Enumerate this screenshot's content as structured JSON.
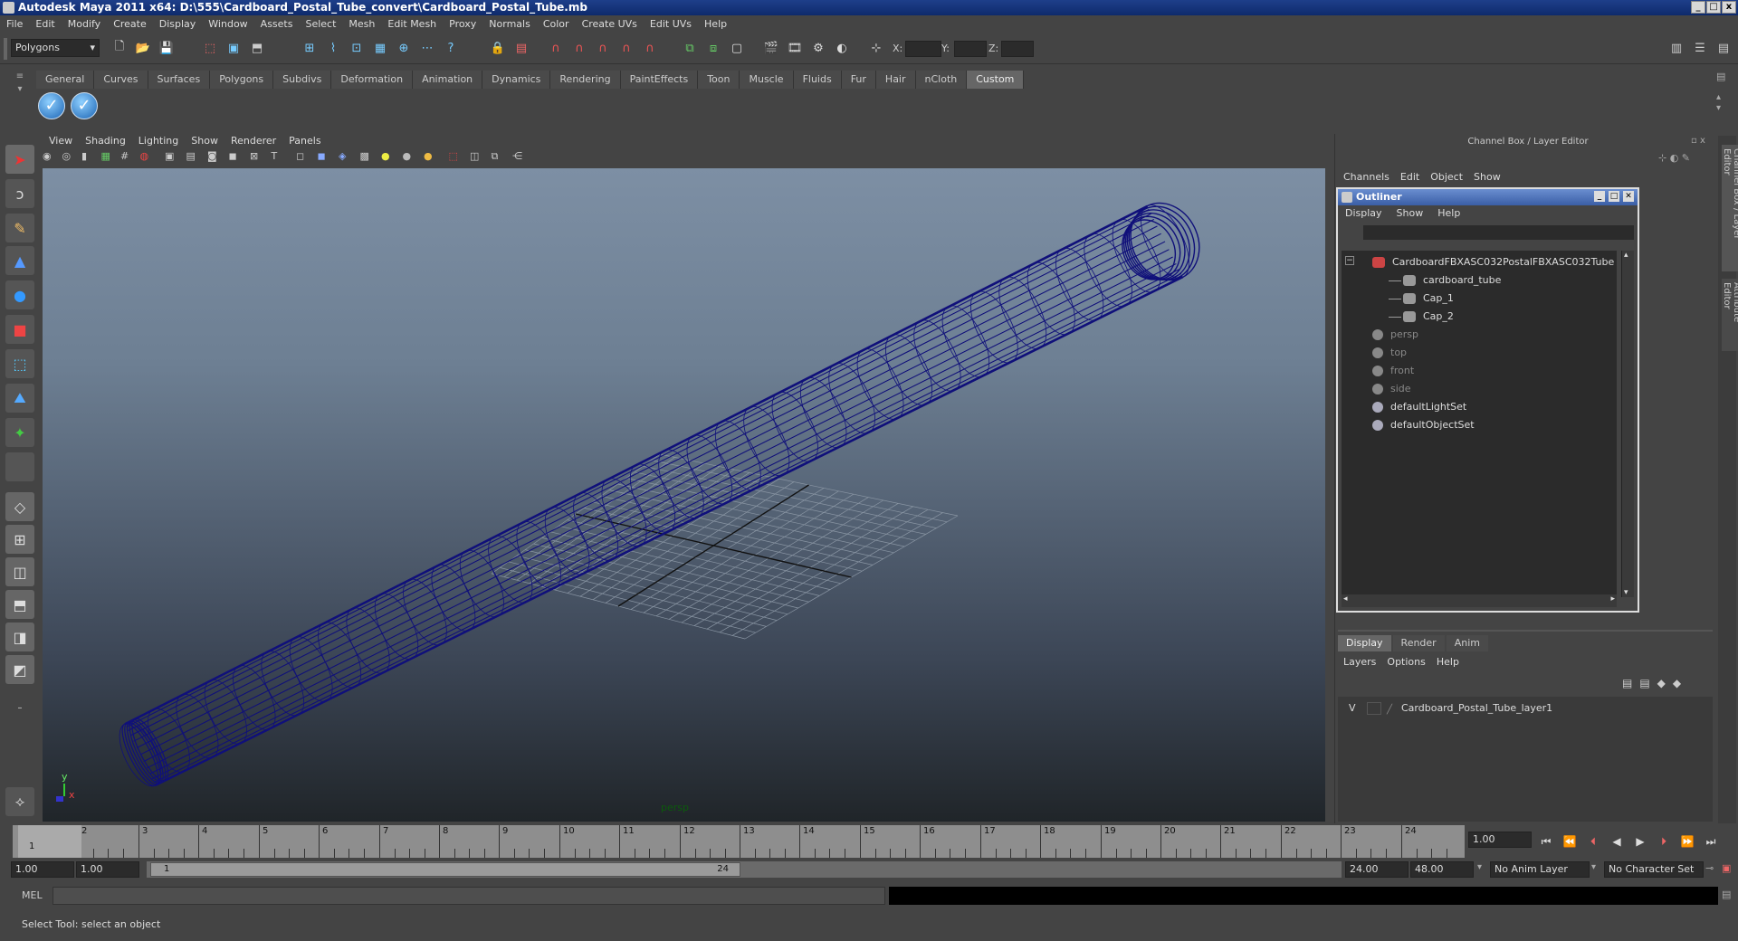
{
  "window": {
    "title": "Autodesk Maya 2011 x64: D:\\555\\Cardboard_Postal_Tube_convert\\Cardboard_Postal_Tube.mb",
    "min": "_",
    "max": "□",
    "close": "x"
  },
  "menubar": [
    "File",
    "Edit",
    "Modify",
    "Create",
    "Display",
    "Window",
    "Assets",
    "Select",
    "Mesh",
    "Edit Mesh",
    "Proxy",
    "Normals",
    "Color",
    "Create UVs",
    "Edit UVs",
    "Help"
  ],
  "statusline": {
    "mode": "Polygons",
    "x_label": "X:",
    "y_label": "Y:",
    "z_label": "Z:"
  },
  "shelf_tabs": [
    "General",
    "Curves",
    "Surfaces",
    "Polygons",
    "Subdivs",
    "Deformation",
    "Animation",
    "Dynamics",
    "Rendering",
    "PaintEffects",
    "Toon",
    "Muscle",
    "Fluids",
    "Fur",
    "Hair",
    "nCloth",
    "Custom"
  ],
  "shelf_active": "Custom",
  "viewport": {
    "menu": [
      "View",
      "Shading",
      "Lighting",
      "Show",
      "Renderer",
      "Panels"
    ],
    "camera_label": "persp",
    "axis_y": "y",
    "axis_x": "x",
    "wire_color": "#10107a"
  },
  "channel_box": {
    "title": "Channel Box / Layer Editor",
    "menu": [
      "Channels",
      "Edit",
      "Object",
      "Show"
    ]
  },
  "outliner": {
    "title": "Outliner",
    "menu": [
      "Display",
      "Show",
      "Help"
    ],
    "items": [
      {
        "label": "CardboardFBXASC032PostalFBXASC032Tube",
        "indent": 0,
        "icon": "transform-icon",
        "dim": false,
        "expand": "−"
      },
      {
        "label": "cardboard_tube",
        "indent": 1,
        "icon": "mesh-icon",
        "dim": false
      },
      {
        "label": "Cap_1",
        "indent": 1,
        "icon": "mesh-icon",
        "dim": false
      },
      {
        "label": "Cap_2",
        "indent": 1,
        "icon": "mesh-icon",
        "dim": false
      },
      {
        "label": "persp",
        "indent": 0,
        "icon": "camera-icon",
        "dim": true
      },
      {
        "label": "top",
        "indent": 0,
        "icon": "camera-icon",
        "dim": true
      },
      {
        "label": "front",
        "indent": 0,
        "icon": "camera-icon",
        "dim": true
      },
      {
        "label": "side",
        "indent": 0,
        "icon": "camera-icon",
        "dim": true
      },
      {
        "label": "defaultLightSet",
        "indent": 0,
        "icon": "set-icon",
        "dim": false
      },
      {
        "label": "defaultObjectSet",
        "indent": 0,
        "icon": "set-icon",
        "dim": false
      }
    ]
  },
  "layer_editor": {
    "tabs": [
      "Display",
      "Render",
      "Anim"
    ],
    "active_tab": "Display",
    "menu": [
      "Layers",
      "Options",
      "Help"
    ],
    "layers": [
      {
        "visible": "V",
        "name": "Cardboard_Postal_Tube_layer1"
      }
    ]
  },
  "timeline": {
    "ticks": [
      "1",
      "2",
      "3",
      "4",
      "5",
      "6",
      "7",
      "8",
      "9",
      "10",
      "11",
      "12",
      "13",
      "14",
      "15",
      "16",
      "17",
      "18",
      "19",
      "20",
      "21",
      "22",
      "23",
      "24"
    ],
    "current_frame": "1.00",
    "current_marker": "1"
  },
  "range": {
    "start": "1.00",
    "playback_start": "1.00",
    "slider_start": "1",
    "slider_end": "24",
    "playback_end": "24.00",
    "end": "48.00",
    "anim_layer": "No Anim Layer",
    "character_set": "No Character Set"
  },
  "command": {
    "lang": "MEL"
  },
  "help_line": "Select Tool: select an object"
}
